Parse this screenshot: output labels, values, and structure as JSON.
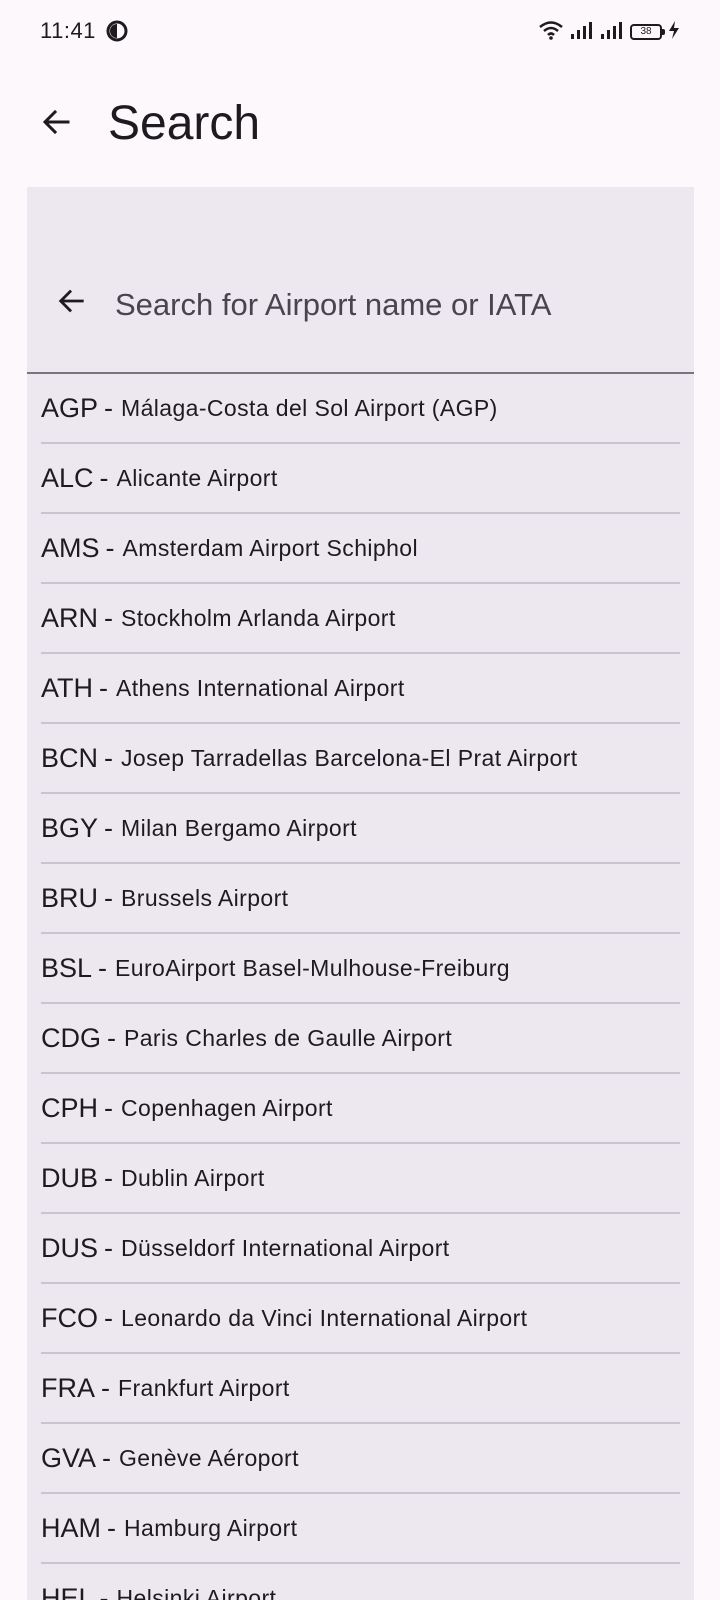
{
  "status_bar": {
    "time": "11:41",
    "battery_level": "38",
    "icons": [
      "app-indicator-icon",
      "wifi-icon",
      "signal-icon",
      "signal-icon",
      "battery-icon",
      "charging-icon"
    ]
  },
  "header": {
    "title": "Search",
    "back_icon": "arrow-left-icon"
  },
  "search": {
    "placeholder": "Search for Airport name or IATA",
    "value": "",
    "back_icon": "arrow-left-icon"
  },
  "separator": "-",
  "results": [
    {
      "code": "AGP",
      "name": "Málaga-Costa del Sol Airport (AGP)"
    },
    {
      "code": "ALC",
      "name": "Alicante Airport"
    },
    {
      "code": "AMS",
      "name": "Amsterdam Airport Schiphol"
    },
    {
      "code": "ARN",
      "name": "Stockholm Arlanda Airport"
    },
    {
      "code": "ATH",
      "name": "Athens International Airport"
    },
    {
      "code": "BCN",
      "name": "Josep Tarradellas Barcelona-El Prat Airport"
    },
    {
      "code": "BGY",
      "name": "Milan Bergamo Airport"
    },
    {
      "code": "BRU",
      "name": "Brussels Airport"
    },
    {
      "code": "BSL",
      "name": "EuroAirport Basel-Mulhouse-Freiburg"
    },
    {
      "code": "CDG",
      "name": "Paris Charles de Gaulle Airport"
    },
    {
      "code": "CPH",
      "name": "Copenhagen Airport"
    },
    {
      "code": "DUB",
      "name": "Dublin Airport"
    },
    {
      "code": "DUS",
      "name": "Düsseldorf International Airport"
    },
    {
      "code": "FCO",
      "name": "Leonardo da Vinci International Airport"
    },
    {
      "code": "FRA",
      "name": "Frankfurt Airport"
    },
    {
      "code": "GVA",
      "name": "Genève Aéroport"
    },
    {
      "code": "HAM",
      "name": "Hamburg Airport"
    },
    {
      "code": "HEL",
      "name": "Helsinki Airport"
    }
  ],
  "colors": {
    "background": "#fdf8fb",
    "panel": "#ede7f0",
    "divider": "#cac4d0",
    "text": "#1d1b20"
  }
}
